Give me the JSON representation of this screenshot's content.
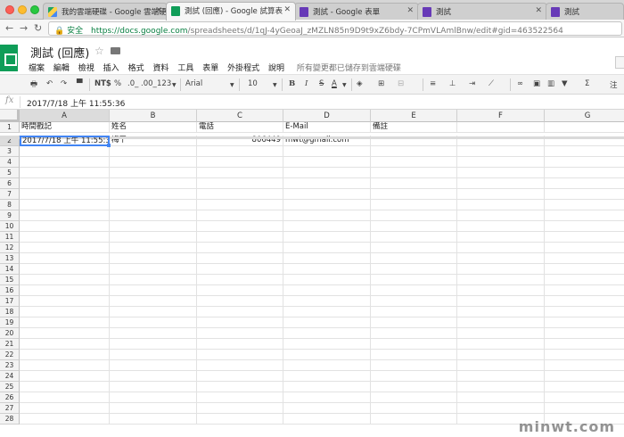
{
  "tabs": [
    {
      "title": "我的雲端硬碟 - Google 雲端硬碟",
      "icon": "drive-icon"
    },
    {
      "title": "測試 (回應) - Google 試算表",
      "icon": "sheets-icon",
      "active": true
    },
    {
      "title": "測試 - Google 表單",
      "icon": "forms-icon"
    },
    {
      "title": "測試",
      "icon": "forms-icon"
    },
    {
      "title": "測試",
      "icon": "forms-icon"
    }
  ],
  "address": {
    "secure_label": "安全",
    "url_host": "https://docs.google.com",
    "url_path": "/spreadsheets/d/1qJ-4yGeoaJ_zMZLN85n9D9t9xZ6bdy-7CPmVLAmlBnw/edit#gid=463522564"
  },
  "doc": {
    "title": "測試 (回應)",
    "save_status": "所有變更都已儲存到雲端硬碟"
  },
  "menu": [
    "檔案",
    "編輯",
    "檢視",
    "插入",
    "格式",
    "資料",
    "工具",
    "表單",
    "外掛程式",
    "說明"
  ],
  "toolbar": {
    "currency": "NT$",
    "percent": "%",
    "decrease_decimals": ".0_",
    "increase_decimals": ".00_",
    "more_formats": "123",
    "font": "Arial",
    "font_size": "10",
    "bold": "B",
    "italic": "I",
    "strike": "S",
    "text_color": "A",
    "comment": "注"
  },
  "formula": {
    "fx_label": "fx",
    "value": "2017/7/18 上午 11:55:36"
  },
  "columns": [
    "A",
    "B",
    "C",
    "D",
    "E",
    "F",
    "G"
  ],
  "rows": {
    "header": [
      "時間戳記",
      "姓名",
      "電話",
      "E-Mail",
      "備註"
    ],
    "data": [
      "2017/7/18 上午 11:55:36",
      "梅干",
      "806449",
      "mwt@gmail.com",
      ""
    ]
  },
  "row_numbers": [
    "1",
    "2",
    "3",
    "4",
    "5",
    "6",
    "7",
    "8",
    "9",
    "10",
    "11",
    "12",
    "13",
    "14",
    "15",
    "16",
    "17",
    "18",
    "19",
    "20",
    "21",
    "22",
    "23",
    "24",
    "25",
    "26",
    "27",
    "28"
  ],
  "watermark": "minwt.com",
  "colors": {
    "sheets_green": "#0f9d58",
    "selection_blue": "#4285f4",
    "secure_green": "#0b8043"
  }
}
